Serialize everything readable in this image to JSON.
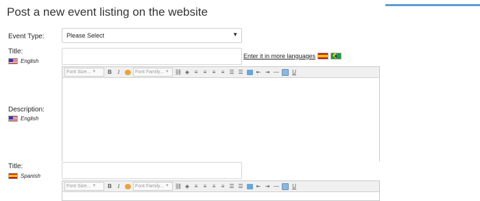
{
  "page": {
    "title": "Post a new event listing on the website"
  },
  "event_type": {
    "label": "Event Type:",
    "selected": "Please Select"
  },
  "title_en": {
    "label": "Title:",
    "language": "English"
  },
  "more_languages": {
    "link_text": "Enter it in more languages",
    "flags": [
      "spain-flag-icon",
      "brazil-flag-icon"
    ]
  },
  "description_en": {
    "label": "Description:",
    "language": "English"
  },
  "title_es": {
    "label": "Title:",
    "language": "Spanish"
  },
  "toolbar": {
    "font_size": "Font Size...",
    "font_family": "Font Family...",
    "bold": "B",
    "italic": "I",
    "underline": "U"
  },
  "colors": {
    "accent": "#5b9bd5",
    "text": "#222222"
  }
}
